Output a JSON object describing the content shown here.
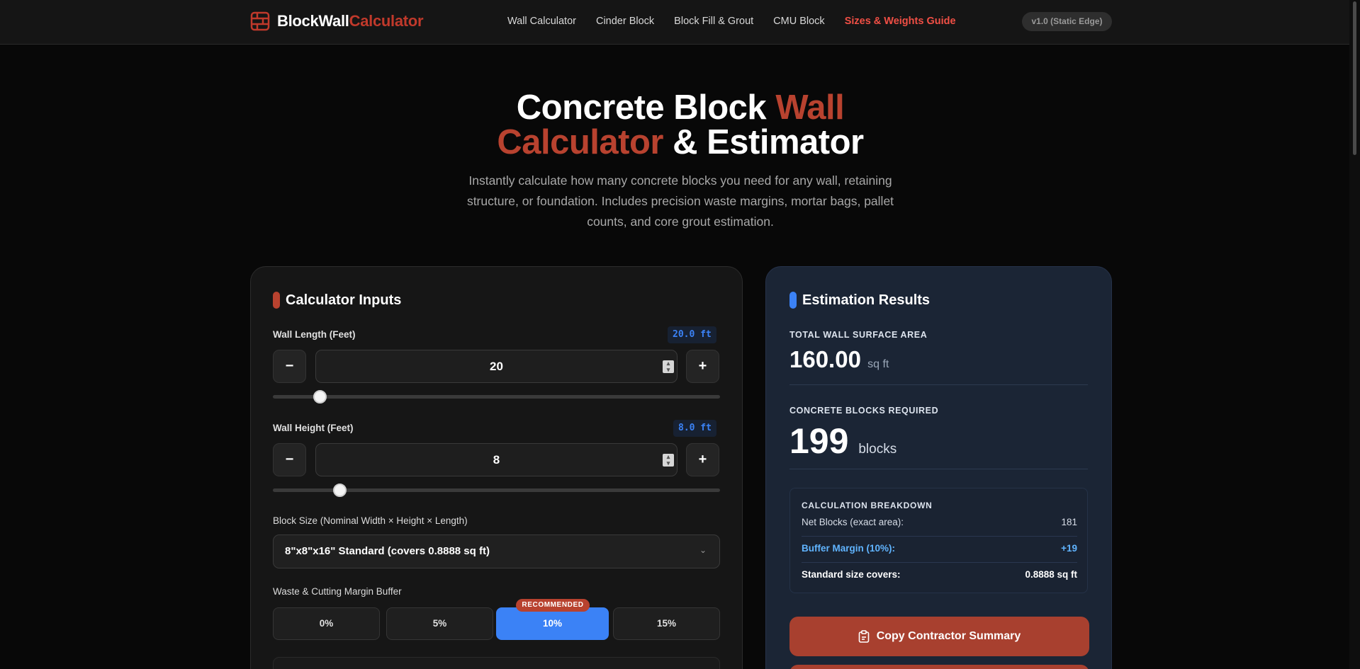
{
  "nav": {
    "logo_part1": "BlockWall",
    "logo_part2": "Calculator",
    "links": [
      "Wall Calculator",
      "Cinder Block",
      "Block Fill & Grout",
      "CMU Block",
      "Sizes & Weights Guide"
    ],
    "version": "v1.0 (Static Edge)"
  },
  "hero": {
    "title_1": "Concrete Block ",
    "title_2": "Wall",
    "title_3": "Calculator",
    "title_4": " & Estimator",
    "subtitle": "Instantly calculate how many concrete blocks you need for any wall, retaining structure, or foundation. Includes precision waste margins, mortar bags, pallet counts, and core grout estimation."
  },
  "inputs": {
    "heading": "Calculator Inputs",
    "length": {
      "label": "Wall Length (Feet)",
      "badge": "20.0 ft",
      "value": "20",
      "slider_fraction": 0.105
    },
    "height": {
      "label": "Wall Height (Feet)",
      "badge": "8.0 ft",
      "value": "8",
      "slider_fraction": 0.15
    },
    "minus": "−",
    "plus": "+",
    "block_size": {
      "label": "Block Size (Nominal Width × Height × Length)",
      "value": "8\"x8\"x16\" Standard (covers 0.8888 sq ft)"
    },
    "waste": {
      "label": "Waste & Cutting Margin Buffer",
      "options": [
        "0%",
        "5%",
        "10%",
        "15%"
      ],
      "selected": "10%",
      "recommended": "RECOMMENDED"
    }
  },
  "results": {
    "heading": "Estimation Results",
    "area_label": "TOTAL WALL SURFACE AREA",
    "area_value": "160.00",
    "area_unit": "sq ft",
    "blocks_label": "CONCRETE BLOCKS REQUIRED",
    "blocks_value": "199",
    "blocks_unit": "blocks",
    "breakdown": {
      "title": "CALCULATION BREAKDOWN",
      "rows": [
        {
          "label": "Net Blocks (exact area):",
          "value": "181"
        },
        {
          "label": "Buffer Margin (10%):",
          "value": "+19"
        },
        {
          "label": "Standard size covers:",
          "value": "0.8888 sq ft"
        }
      ]
    },
    "copy_button": "Copy Contractor Summary"
  },
  "colors": {
    "accent_red": "#b8422f",
    "accent_blue": "#3b82f6",
    "active_nav": "#f04f45"
  }
}
